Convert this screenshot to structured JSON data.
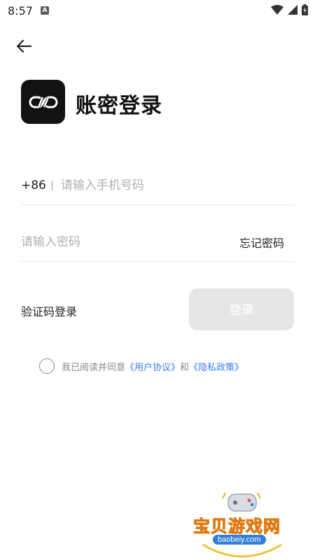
{
  "status_bar": {
    "time": "8:57",
    "notification_icon": "A"
  },
  "header": {
    "title": "账密登录",
    "logo_icon": "link-logo-icon"
  },
  "form": {
    "country_code": "+86",
    "phone_placeholder": "请输入手机号码",
    "password_placeholder": "请输入密码",
    "forgot_password_label": "忘记密码"
  },
  "actions": {
    "sms_login_label": "验证码登录",
    "login_label": "登录"
  },
  "agreement": {
    "prefix": "我已阅读并同意",
    "user_agreement": "《用户协议》",
    "conjunction": "和",
    "privacy_policy": "《隐私政策》"
  },
  "watermark": {
    "brand": "宝贝游戏网",
    "domain": "baobeiy.com"
  },
  "colors": {
    "accent_link": "#3b7de8",
    "button_disabled": "#e6e6e6",
    "logo_bg": "#121212"
  }
}
